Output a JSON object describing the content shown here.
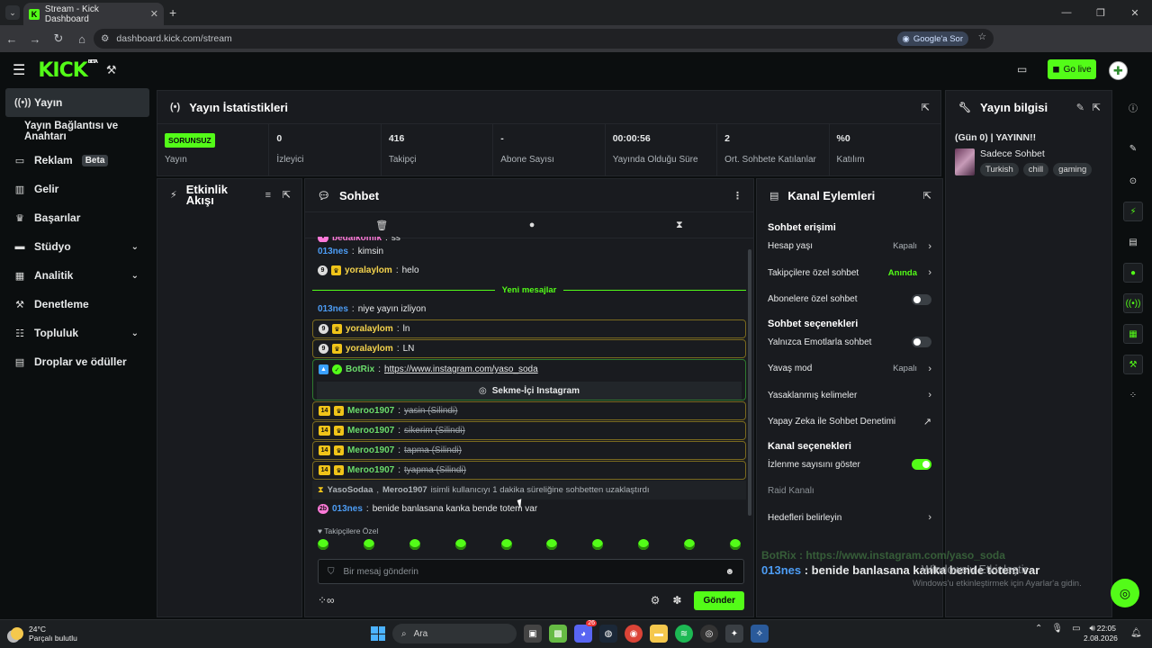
{
  "browser": {
    "tab_title": "Stream - Kick Dashboard",
    "url": "dashboard.kick.com/stream",
    "google_sor": "Google'a Sor"
  },
  "header": {
    "logo": "KICK",
    "logo_badge": "BETA",
    "go_live": "Go live"
  },
  "sidebar": {
    "items": [
      {
        "label": "Yayın"
      },
      {
        "label": "Yayın Bağlantısı ve Anahtarı"
      },
      {
        "label": "Reklam",
        "badge": "Beta"
      },
      {
        "label": "Gelir"
      },
      {
        "label": "Başarılar"
      },
      {
        "label": "Stüdyo"
      },
      {
        "label": "Analitik"
      },
      {
        "label": "Denetleme"
      },
      {
        "label": "Topluluk"
      },
      {
        "label": "Droplar ve ödüller"
      }
    ]
  },
  "stats": {
    "title": "Yayın İstatistikleri",
    "status": "SORUNSUZ",
    "cells": [
      {
        "value": "",
        "label": "Yayın"
      },
      {
        "value": "0",
        "label": "İzleyici"
      },
      {
        "value": "416",
        "label": "Takipçi"
      },
      {
        "value": "-",
        "label": "Abone Sayısı"
      },
      {
        "value": "00:00:56",
        "label": "Yayında Olduğu Süre"
      },
      {
        "value": "2",
        "label": "Ort. Sohbete Katılanlar"
      },
      {
        "value": "%0",
        "label": "Katılım"
      }
    ]
  },
  "info": {
    "title": "Yayın bilgisi",
    "stream_title": "(Gün 0) | YAYINN!!",
    "category": "Sadece Sohbet",
    "tags": [
      "Turkish",
      "chill",
      "gaming"
    ]
  },
  "activity": {
    "title": "Etkinlik Akışı"
  },
  "chat": {
    "title": "Sohbet",
    "top_user": "bedaikomik",
    "top_msg": "ss",
    "messages": [
      {
        "user": "013nes",
        "text": "kimsin"
      },
      {
        "user": "yoralaylom",
        "text": "helo"
      }
    ],
    "new_messages": "Yeni mesajlar",
    "after": [
      {
        "user": "013nes",
        "text": "niye yayın izliyon"
      },
      {
        "user": "yoralaylom",
        "text": "ln"
      },
      {
        "user": "yoralaylom",
        "text": "LN"
      }
    ],
    "bot": {
      "user": "BotRix",
      "link": "https://www.instagram.com/yaso_soda",
      "button": "Sekme-İçi Instagram"
    },
    "deleted": [
      {
        "user": "Meroo1907",
        "text": "yasin (Silindi)"
      },
      {
        "user": "Meroo1907",
        "text": "sikerim (Silindi)"
      },
      {
        "user": "Meroo1907",
        "text": "tapma (Silindi)"
      },
      {
        "user": "Meroo1907",
        "text": "tyapma (Silindi)"
      }
    ],
    "mod_event": {
      "mod": "YasoSodaa",
      "user": "Meroo1907",
      "text": "isimli kullanıcıyı 1 dakika süreliğine sohbetten uzaklaştırdı"
    },
    "last": {
      "user": "013nes",
      "text": "benide banlasana kanka bende totem var"
    },
    "followers_only": "Takipçilere Özel",
    "placeholder": "Bir mesaj gönderin",
    "send": "Gönder"
  },
  "channel": {
    "title": "Kanal Eylemleri",
    "chat_access": "Sohbet erişimi",
    "account_age": "Hesap yaşı",
    "account_age_val": "Kapalı",
    "followers_chat": "Takipçilere özel sohbet",
    "followers_chat_val": "Anında",
    "subs_chat": "Abonelere özel sohbet",
    "chat_options": "Sohbet seçenekleri",
    "emote_only": "Yalnızca Emotlarla sohbet",
    "slow_mode": "Yavaş mod",
    "slow_mode_val": "Kapalı",
    "banned_words": "Yasaklanmış kelimeler",
    "ai_mod": "Yapay Zeka ile Sohbet Denetimi",
    "channel_options": "Kanal seçenekleri",
    "show_views": "İzlenme sayısını göster",
    "raid": "Raid Kanalı",
    "goals": "Hedefleri belirleyin"
  },
  "overlay": {
    "bot_line": "BotRix : https://www.instagram.com/yaso_soda",
    "user": "013nes",
    "text": ": benide banlasana kanka bende totem var"
  },
  "windows": {
    "activate": "Windows'u Etkinleştir",
    "activate_sub": "Windows'u etkinleştirmek için Ayarlar'a gidin.",
    "temp": "24°C",
    "weather": "Parçalı bulutlu",
    "search": "Ara",
    "time": "22:05",
    "date": "2.08.2026",
    "notif_count": "26"
  },
  "colors": {
    "accent": "#53fc18",
    "bg": "#0b0e0f",
    "panel": "#191b1f"
  }
}
